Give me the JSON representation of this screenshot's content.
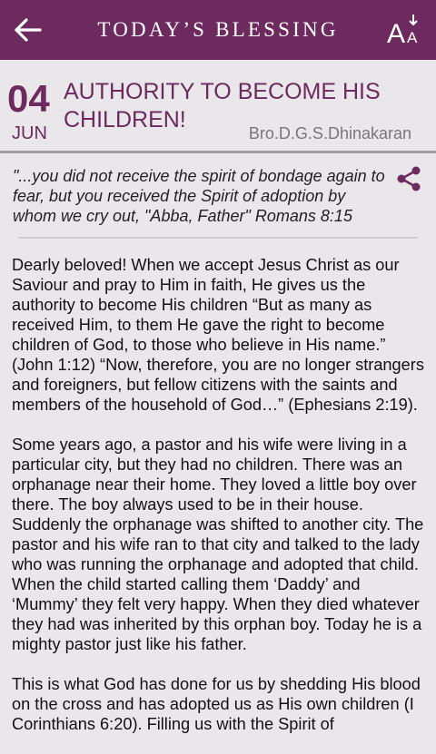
{
  "header": {
    "title": "TODAY’S BLESSING",
    "back_icon": "arrow-left-icon",
    "font_size_icon": "text-size-icon",
    "background": "#6d2a5f"
  },
  "date": {
    "day": "04",
    "month": "JUN"
  },
  "message": {
    "title": "AUTHORITY TO BECOME HIS CHILDREN!",
    "author": "Bro.D.G.S.Dhinakaran",
    "verse": "\"...you did not receive the spirit of bondage again to fear, but you received the Spirit of adoption by whom we cry out, \"Abba, Father\" Romans 8:15",
    "share_icon": "share-icon",
    "paragraphs": [
      "Dearly beloved! When we accept Jesus Christ as our Saviour and pray to Him in faith, He gives us the authority to become His children “But as many as received Him, to them He gave the right to become children of God, to those who believe in His name.” (John 1:12) “Now, therefore, you are no longer strangers and foreigners, but fellow citizens with the saints and members of the household of God…” (Ephesians 2:19).",
      "Some years ago, a pastor and his wife were living in a particular city, but they had no children. There was an orphanage near their home. They loved a little boy over there. The boy always used to be in their house. Suddenly the orphanage was shifted to another city. The pastor and his wife ran to that city and talked to the lady who was running the orphanage and adopted that child. When the child started calling them ‘Daddy’ and ‘Mummy’ they felt very happy. When they died whatever they had was inherited by this orphan boy. Today he is a mighty pastor just like his father.",
      "This is what God has done for us by shedding His blood on the cross and has adopted us as His own children (I Corinthians 6:20). Filling us with the Spirit of"
    ]
  }
}
